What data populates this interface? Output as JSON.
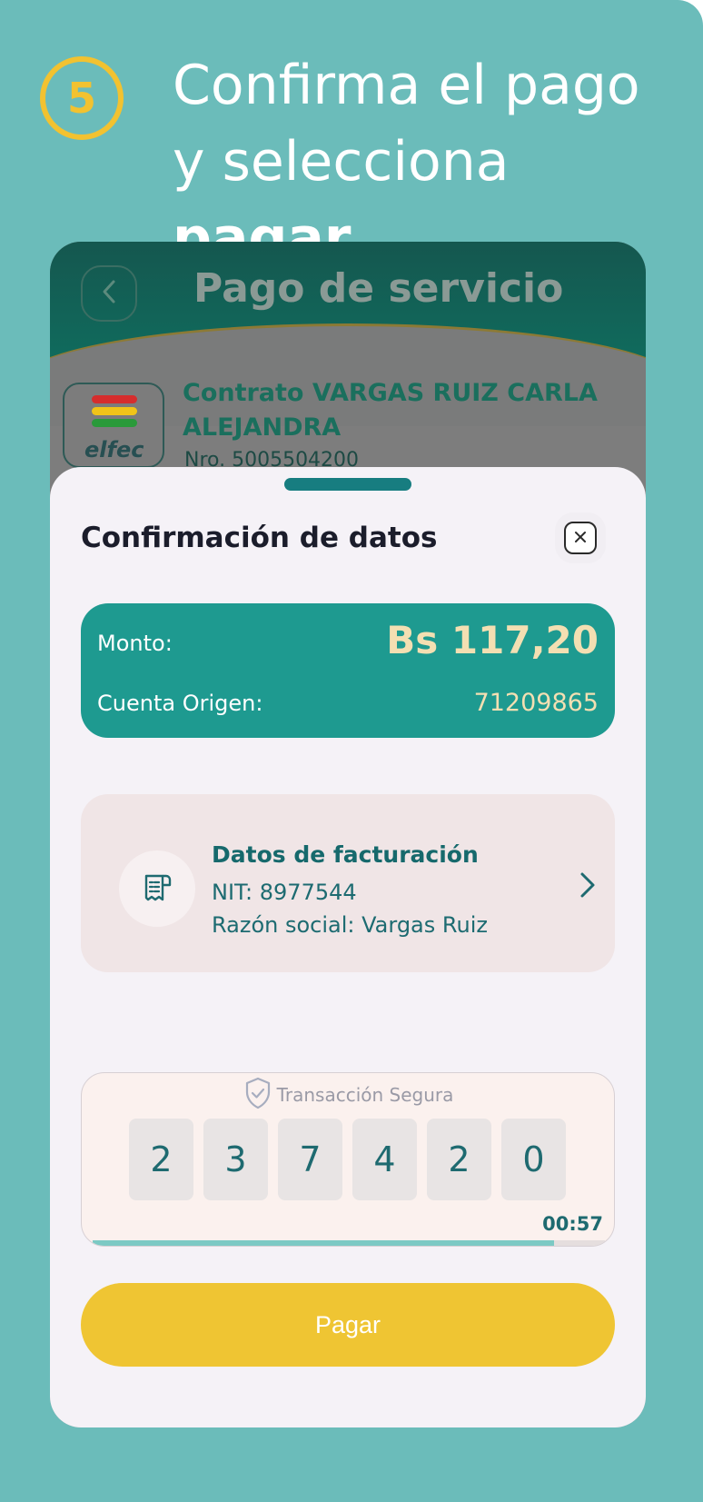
{
  "step": {
    "number": "5",
    "line1": "Confirma el pago",
    "line2_prefix": "y selecciona ",
    "line2_bold": "pagar"
  },
  "app": {
    "title": "Pago de servicio",
    "back_icon": "chevron-left-icon",
    "contract": {
      "logo_text": "elfec",
      "logo_colors": [
        "#d62d2d",
        "#f0c419",
        "#2a9a3a"
      ],
      "name": "Contrato VARGAS RUIZ CARLA ALEJANDRA",
      "number": "Nro. 5005504200"
    }
  },
  "sheet": {
    "title": "Confirmación de datos",
    "close_icon": "close-icon",
    "amount_label": "Monto:",
    "amount_value": "Bs 117,20",
    "origin_label": "Cuenta Origen:",
    "origin_value": "71209865",
    "billing": {
      "title": "Datos de facturación",
      "nit": "NIT: 8977544",
      "razon": "Razón social: Vargas Ruiz",
      "icon": "receipt-icon",
      "chevron_icon": "chevron-right-icon"
    },
    "secure": {
      "label": "Transacción Segura",
      "icon": "shield-check-icon",
      "digits": [
        "2",
        "3",
        "7",
        "4",
        "2",
        "0"
      ],
      "timer": "00:57",
      "progress": 0.9
    },
    "pay_button": "Pagar"
  },
  "colors": {
    "background": "#6bbcba",
    "accent_yellow": "#efc533",
    "teal_card": "#1e9a90",
    "amount_text": "#f3dfb2"
  }
}
